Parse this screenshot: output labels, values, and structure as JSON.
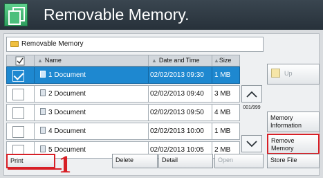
{
  "header": {
    "title": "Removable Memory."
  },
  "path_bar": {
    "text": "Removable Memory"
  },
  "table": {
    "columns": {
      "name": "Name",
      "date": "Date and Time",
      "size": "Size"
    },
    "rows": [
      {
        "num": "1",
        "name": "Document",
        "date": "02/02/2013 09:30",
        "size": "1 MB",
        "selected": true
      },
      {
        "num": "2",
        "name": "Document",
        "date": "02/02/2013 09:40",
        "size": "3 MB",
        "selected": false
      },
      {
        "num": "3",
        "name": "Document",
        "date": "02/02/2013 09:50",
        "size": "4 MB",
        "selected": false
      },
      {
        "num": "4",
        "name": "Document",
        "date": "02/02/2013 10:00",
        "size": "1 MB",
        "selected": false
      },
      {
        "num": "5",
        "name": "Document",
        "date": "02/02/2013 10:05",
        "size": "2 MB",
        "selected": false
      }
    ]
  },
  "pagination": {
    "counter": "001/999"
  },
  "buttons": {
    "up": "Up",
    "memory_info": "Memory Information",
    "remove_memory": "Remove Memory",
    "print": "Print",
    "delete": "Delete",
    "detail": "Detail",
    "open": "Open",
    "store_file": "Store File"
  },
  "callout": {
    "label": "1"
  },
  "icons": {
    "header": "copy-document-icon",
    "folder": "folder-icon",
    "doc": "document-icon",
    "scroll_up": "chevron-up-icon",
    "scroll_down": "chevron-down-icon",
    "up": "folder-up-icon"
  },
  "colors": {
    "accent": "#1e88d0",
    "highlight": "#d71f26",
    "header": "#2f3a44"
  }
}
